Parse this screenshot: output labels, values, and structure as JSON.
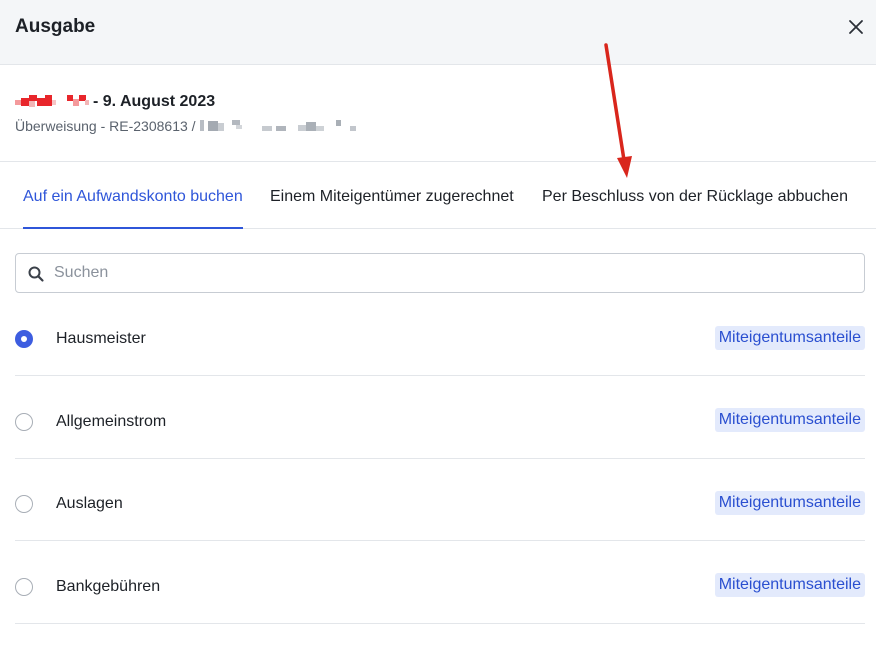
{
  "header": {
    "title": "Ausgabe"
  },
  "info": {
    "title": "- 9. August 2023",
    "subtitle": "Überweisung - RE-2308613 /"
  },
  "tabs": [
    {
      "label": "Auf ein Aufwandskonto buchen",
      "active": true
    },
    {
      "label": "Einem Miteigentümer zugerechnet",
      "active": false
    },
    {
      "label": "Per Beschluss von der Rücklage abbuchen",
      "active": false
    }
  ],
  "search": {
    "placeholder": "Suchen",
    "value": ""
  },
  "accounts": [
    {
      "label": "Hausmeister",
      "badge": "Miteigentumsanteile",
      "selected": true
    },
    {
      "label": "Allgemeinstrom",
      "badge": "Miteigentumsanteile",
      "selected": false
    },
    {
      "label": "Auslagen",
      "badge": "Miteigentumsanteile",
      "selected": false
    },
    {
      "label": "Bankgebühren",
      "badge": "Miteigentumsanteile",
      "selected": false
    }
  ],
  "colors": {
    "accent": "#2f56d9",
    "badge_bg": "#e3eafc",
    "annotation_arrow": "#d9261c",
    "redaction": "#e8262b"
  },
  "icons": {
    "close": "close-icon",
    "search": "search-icon"
  }
}
